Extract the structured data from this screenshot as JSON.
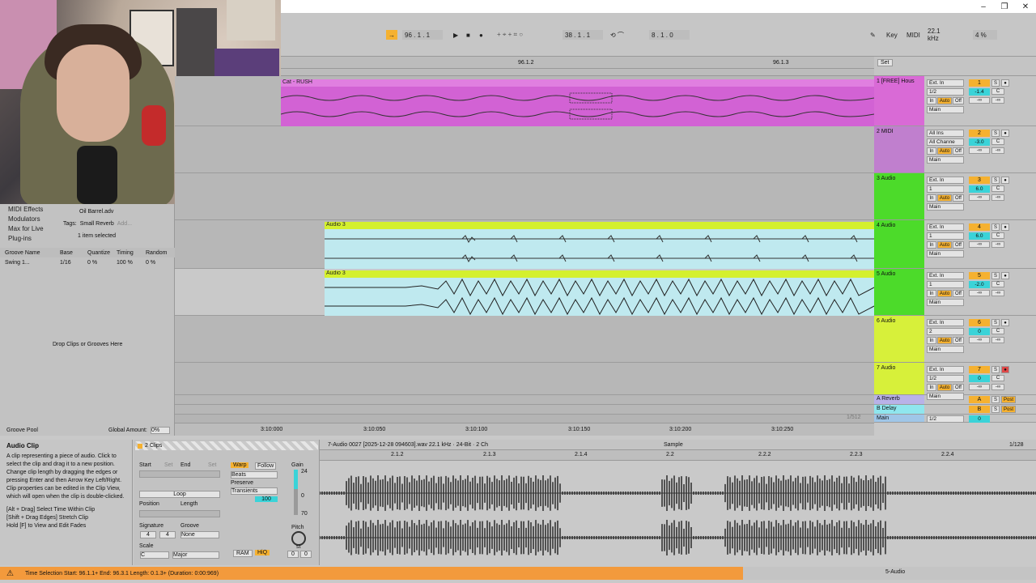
{
  "window": {
    "minimize": "–",
    "restore": "❐",
    "close": "✕"
  },
  "transport": {
    "arrangement_position": "96 . 1 . 1",
    "loop_start": "38 . 1 . 1",
    "loop_length": "8 . 1 . 0",
    "key_label": "Key",
    "midi_label": "MIDI",
    "sample_rate": "22.1 kHz",
    "cpu": "4 %"
  },
  "ruler": {
    "marks": [
      "96.1.2",
      "96.1.3"
    ],
    "set_label": "Set"
  },
  "browser": {
    "categories": [
      "MIDI Effects",
      "Modulators",
      "Max for Live",
      "Plug-ins"
    ],
    "file": "Oil Barrel.adv",
    "tags_label": "Tags:",
    "tag": "Small Reverb",
    "tag_add": "Add...",
    "selection_status": "1 item selected",
    "groove_headers": [
      "Groove Name",
      "Base",
      "Quantize",
      "Timing",
      "Random"
    ],
    "groove_row": {
      "name": "Swing 1...",
      "base": "1/16",
      "quantize": "0 %",
      "timing": "100 %",
      "random": "0 %"
    },
    "drop_hint": "Drop Clips or Grooves Here",
    "pool_label": "Groove Pool",
    "global_amount_label": "Global Amount:",
    "global_amount": "0%"
  },
  "clips": {
    "clip1_name": "Cat - RUSH",
    "clip4_name": "Audio 3",
    "clip5_name": "Audio 3"
  },
  "tracks": [
    {
      "name": "1 [FREE] Hous",
      "input": "Ext. In",
      "channel": "1/2",
      "output": "Main",
      "num": "1",
      "vol": "-1.4",
      "pan": "C",
      "color": "#d96ad6",
      "monitor_auto": false
    },
    {
      "name": "2 MIDI",
      "input": "All Ins",
      "channel": "All Channe",
      "output": "Main",
      "num": "2",
      "vol": "-3.0",
      "pan": "C",
      "color": "#c07fce",
      "monitor_auto": true
    },
    {
      "name": "3 Audio",
      "input": "Ext. In",
      "channel": "1",
      "output": "Main",
      "num": "3",
      "vol": "6.0",
      "pan": "C",
      "color": "#4cdb2a",
      "monitor_auto": false
    },
    {
      "name": "4 Audio",
      "input": "Ext. In",
      "channel": "1",
      "output": "Main",
      "num": "4",
      "vol": "6.0",
      "pan": "C",
      "color": "#4cdb2a",
      "monitor_auto": false
    },
    {
      "name": "5 Audio",
      "input": "Ext. In",
      "channel": "1",
      "output": "Main",
      "num": "5",
      "vol": "-2.0",
      "pan": "C",
      "color": "#4cdb2a",
      "monitor_auto": false
    },
    {
      "name": "6 Audio",
      "input": "Ext. In",
      "channel": "2",
      "output": "Main",
      "num": "6",
      "vol": "0",
      "pan": "C",
      "color": "#d7f03a",
      "monitor_auto": false
    },
    {
      "name": "7 Audio",
      "input": "Ext. In",
      "channel": "1/2",
      "output": "Main",
      "num": "7",
      "vol": "0",
      "pan": "C",
      "color": "#d7f03a",
      "monitor_auto": false
    }
  ],
  "returns": [
    {
      "name": "A Reverb",
      "letter": "A",
      "post": "Post"
    },
    {
      "name": "B Delay",
      "letter": "B",
      "post": "Post"
    }
  ],
  "main": {
    "name": "Main",
    "channel": "1/2",
    "vol": "0"
  },
  "arrangement": {
    "timeline": [
      "3:10:000",
      "3:10:050",
      "3:10:100",
      "3:10:150",
      "3:10:200",
      "3:10:250"
    ],
    "zoom": "1/512"
  },
  "info": {
    "title": "Audio Clip",
    "body": "A clip representing a piece of audio. Click to select the clip and drag it to a new position. Change clip length by dragging the edges or pressing Enter and then Arrow Key Left/Right. Clip properties can be edited in the Clip View, which will open when the clip is double-clicked.",
    "hint1": "[Alt + Drag] Select Time Within Clip",
    "hint2": "[Shift + Drag Edges] Stretch Clip",
    "hint3": "Hold [F] to View and Edit Fades"
  },
  "clipview": {
    "title": "2 Clips",
    "start_label": "Start",
    "end_label": "End",
    "set": "Set",
    "loop_label": "Loop",
    "position_label": "Position",
    "length_label": "Length",
    "signature_label": "Signature",
    "groove_label": "Groove",
    "sig_num": "4",
    "sig_den": "4",
    "groove_value": "None",
    "scale_label": "Scale",
    "scale_root": "C",
    "scale_mode": "Major",
    "warp": "Warp",
    "follow": "Follow",
    "beats": "Beats",
    "preserve_label": "Preserve",
    "preserve": "Transients",
    "transient_value": "100",
    "gain_label": "Gain",
    "gain_top": "24",
    "gain_mid": "0",
    "gain_bot": "70",
    "pitch_label": "Pitch",
    "pitch_st": "st",
    "pitch_values": [
      "0",
      "0"
    ],
    "ram": "RAM",
    "hiq": "HiQ"
  },
  "sample": {
    "file_info": "7-Audio 0027 [2025-12-28 094603].wav  22.1 kHz · 24-Bit · 2 Ch",
    "tab": "Sample",
    "quantize": "1/128",
    "ruler": [
      "2.1.2",
      "2.1.3",
      "2.1.4",
      "2.2",
      "2.2.2",
      "2.2.3",
      "2.2.4"
    ]
  },
  "status": {
    "text": "Time Selection   Start: 96.1.1+   End: 96.3.1   Length: 0.1.3+ (Duration: 0:00:969)",
    "track": "5-Audio"
  },
  "colors": {
    "accent": "#f5b130",
    "cyan": "#3ad3d8",
    "status": "#f39a3c",
    "pink": "#d96ad6",
    "green": "#4cdb2a",
    "lime": "#d7f03a"
  }
}
